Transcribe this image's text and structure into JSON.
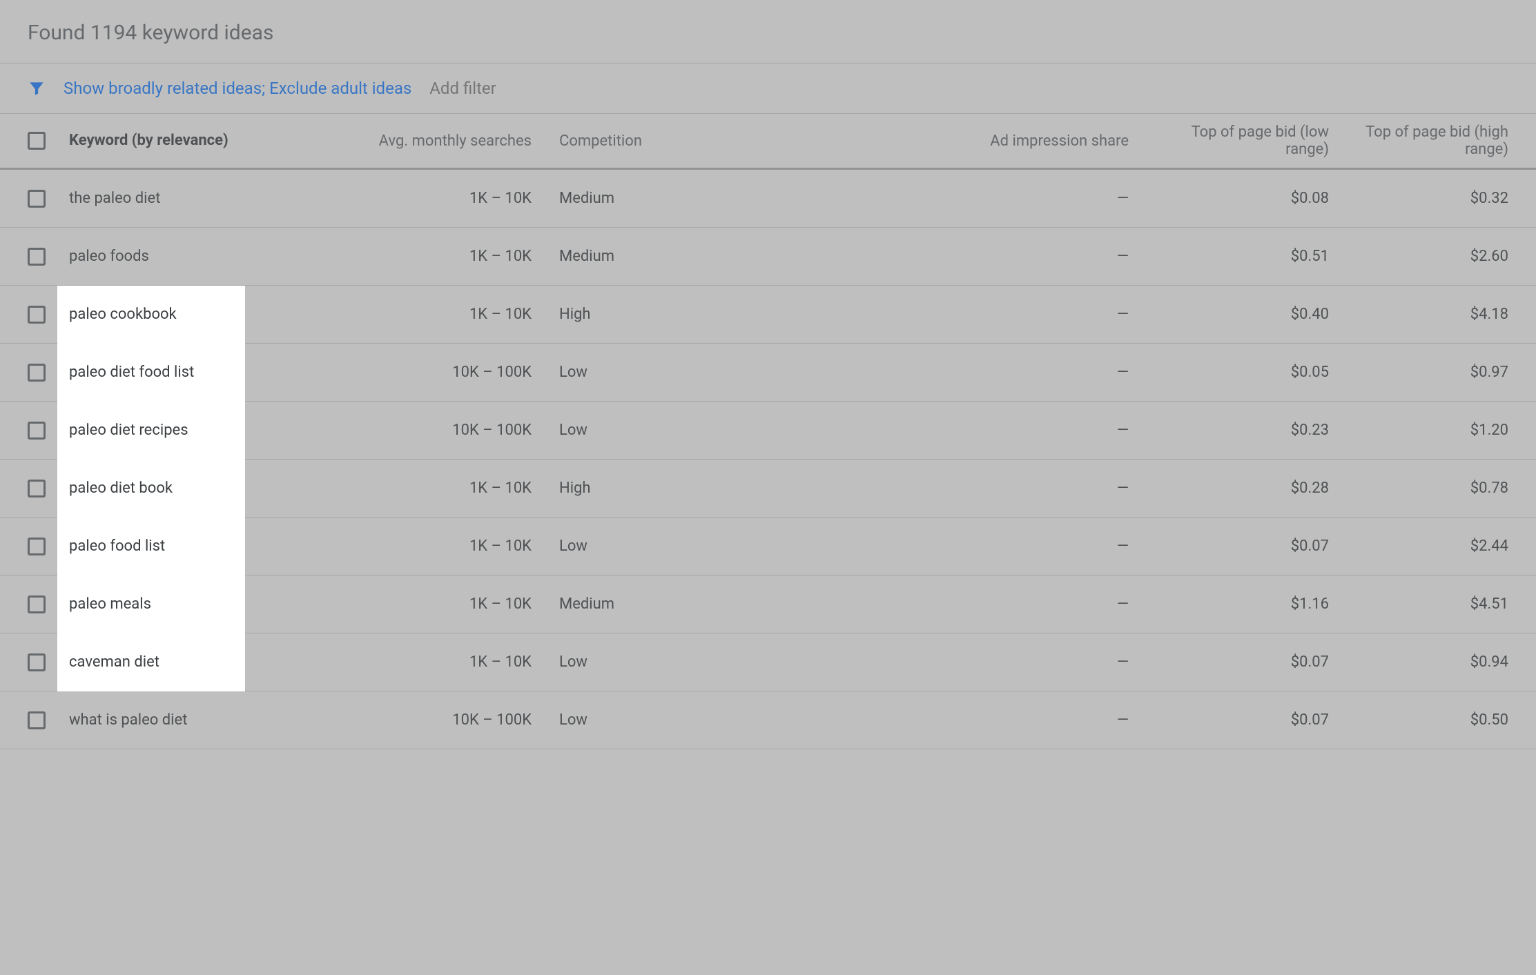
{
  "header": {
    "title": "Found 1194 keyword ideas"
  },
  "filter": {
    "active_text": "Show broadly related ideas; Exclude adult ideas",
    "add_filter": "Add filter"
  },
  "columns": {
    "keyword": "Keyword (by relevance)",
    "avg": "Avg. monthly searches",
    "competition": "Competition",
    "impression": "Ad impression share",
    "low": "Top of page bid (low range)",
    "high": "Top of page bid (high range)"
  },
  "rows": [
    {
      "keyword": "the paleo diet",
      "avg": "1K – 10K",
      "competition": "Medium",
      "impression": "—",
      "low": "$0.08",
      "high": "$0.32",
      "highlight": false
    },
    {
      "keyword": "paleo foods",
      "avg": "1K – 10K",
      "competition": "Medium",
      "impression": "—",
      "low": "$0.51",
      "high": "$2.60",
      "highlight": false
    },
    {
      "keyword": "paleo cookbook",
      "avg": "1K – 10K",
      "competition": "High",
      "impression": "—",
      "low": "$0.40",
      "high": "$4.18",
      "highlight": true
    },
    {
      "keyword": "paleo diet food list",
      "avg": "10K – 100K",
      "competition": "Low",
      "impression": "—",
      "low": "$0.05",
      "high": "$0.97",
      "highlight": true
    },
    {
      "keyword": "paleo diet recipes",
      "avg": "10K – 100K",
      "competition": "Low",
      "impression": "—",
      "low": "$0.23",
      "high": "$1.20",
      "highlight": true
    },
    {
      "keyword": "paleo diet book",
      "avg": "1K – 10K",
      "competition": "High",
      "impression": "—",
      "low": "$0.28",
      "high": "$0.78",
      "highlight": true
    },
    {
      "keyword": "paleo food list",
      "avg": "1K – 10K",
      "competition": "Low",
      "impression": "—",
      "low": "$0.07",
      "high": "$2.44",
      "highlight": true
    },
    {
      "keyword": "paleo meals",
      "avg": "1K – 10K",
      "competition": "Medium",
      "impression": "—",
      "low": "$1.16",
      "high": "$4.51",
      "highlight": true
    },
    {
      "keyword": "caveman diet",
      "avg": "1K – 10K",
      "competition": "Low",
      "impression": "—",
      "low": "$0.07",
      "high": "$0.94",
      "highlight": true
    },
    {
      "keyword": "what is paleo diet",
      "avg": "10K – 100K",
      "competition": "Low",
      "impression": "—",
      "low": "$0.07",
      "high": "$0.50",
      "highlight": false
    }
  ]
}
